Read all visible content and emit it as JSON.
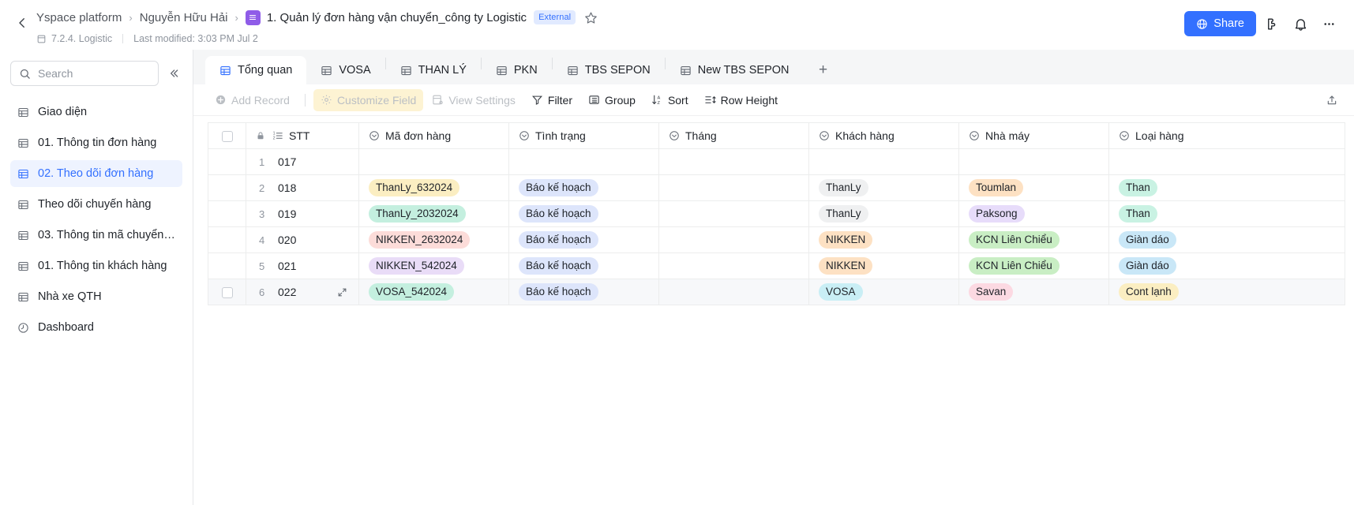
{
  "header": {
    "back_icon": "chevron-left-icon",
    "breadcrumb": [
      {
        "label": "Yspace platform"
      },
      {
        "label": "Nguyễn Hữu Hải"
      }
    ],
    "title": "1. Quản lý đơn hàng vận chuyển_công ty Logistic",
    "badge": "External",
    "star_icon": "star-icon",
    "doc_icon": "base-table-icon",
    "sub_icon": "file-icon",
    "sub_label": "7.2.4. Logistic",
    "last_modified": "Last modified: 3:03 PM Jul 2",
    "share_label": "Share",
    "share_icon": "globe-icon",
    "share_color": "#3370ff",
    "actions": [
      {
        "icon": "extension-icon"
      },
      {
        "icon": "bell-icon"
      },
      {
        "icon": "more-horizontal-icon"
      }
    ]
  },
  "sidebar": {
    "search": {
      "placeholder": "Search",
      "value": "",
      "icon": "search-icon"
    },
    "collapse_icon": "double-chevron-left-icon",
    "items": [
      {
        "label": "Giao diện",
        "icon": "table-icon",
        "active": false
      },
      {
        "label": "01. Thông tin đơn hàng",
        "icon": "table-icon",
        "active": false
      },
      {
        "label": "02. Theo dõi đơn hàng",
        "icon": "table-icon",
        "active": true
      },
      {
        "label": "Theo dõi chuyến hàng",
        "icon": "table-icon",
        "active": false
      },
      {
        "label": "03. Thông tin mã chuyển h...",
        "icon": "table-icon",
        "active": false
      },
      {
        "label": "01. Thông tin khách hàng",
        "icon": "table-icon",
        "active": false
      },
      {
        "label": "Nhà xe QTH",
        "icon": "table-icon",
        "active": false
      },
      {
        "label": "Dashboard",
        "icon": "dashboard-icon",
        "active": false
      }
    ]
  },
  "tabs": {
    "items": [
      {
        "label": "Tổng quan",
        "icon": "table-icon",
        "active": true
      },
      {
        "label": "VOSA",
        "icon": "table-icon",
        "active": false
      },
      {
        "label": "THAN LÝ",
        "icon": "table-icon",
        "active": false
      },
      {
        "label": "PKN",
        "icon": "table-icon",
        "active": false
      },
      {
        "label": "TBS SEPON",
        "icon": "table-icon",
        "active": false
      },
      {
        "label": "New TBS SEPON",
        "icon": "table-icon",
        "active": false
      }
    ],
    "add_label": "+"
  },
  "toolbar": {
    "add_record": {
      "label": "Add Record",
      "icon": "plus-circle-icon",
      "disabled": true
    },
    "customize_field": {
      "label": "Customize Field",
      "icon": "gear-icon",
      "disabled": true,
      "highlighted": true,
      "highlight_color": "#fdf3d3"
    },
    "view_settings": {
      "label": "View Settings",
      "icon": "view-settings-icon",
      "disabled": true
    },
    "filter": {
      "label": "Filter",
      "icon": "filter-icon"
    },
    "group": {
      "label": "Group",
      "icon": "group-icon"
    },
    "sort": {
      "label": "Sort",
      "icon": "sort-icon"
    },
    "row_height": {
      "label": "Row Height",
      "icon": "row-height-icon"
    },
    "share_view_icon": "share-arrow-icon"
  },
  "grid": {
    "columns": [
      {
        "key": "stt",
        "label": "STT",
        "icon": "autonumber-icon",
        "locked": true
      },
      {
        "key": "ma_don_hang",
        "label": "Mã đơn hàng",
        "icon": "single-select-icon"
      },
      {
        "key": "tinh_trang",
        "label": "Tình trạng",
        "icon": "single-select-icon"
      },
      {
        "key": "thang",
        "label": "Tháng",
        "icon": "single-select-icon"
      },
      {
        "key": "khach_hang",
        "label": "Khách hàng",
        "icon": "single-select-icon"
      },
      {
        "key": "nha_may",
        "label": "Nhà máy",
        "icon": "single-select-icon"
      },
      {
        "key": "loai_hang",
        "label": "Loại hàng",
        "icon": "single-select-icon"
      }
    ],
    "rows": [
      {
        "num": "1",
        "stt": "017",
        "ma_don_hang": null,
        "tinh_trang": null,
        "thang": null,
        "khach_hang": null,
        "nha_may": null,
        "loai_hang": null,
        "hover": false
      },
      {
        "num": "2",
        "stt": "018",
        "ma_don_hang": {
          "text": "ThanLy_632024",
          "color": "#fbeec2"
        },
        "tinh_trang": {
          "text": "Báo kế hoạch",
          "color": "#dde5fb"
        },
        "thang": null,
        "khach_hang": {
          "text": "ThanLy",
          "color": "#eff0f1"
        },
        "nha_may": {
          "text": "Toumlan",
          "color": "#fde1c3"
        },
        "loai_hang": {
          "text": "Than",
          "color": "#c9f2e3"
        },
        "hover": false
      },
      {
        "num": "3",
        "stt": "019",
        "ma_don_hang": {
          "text": "ThanLy_2032024",
          "color": "#c4efdf"
        },
        "tinh_trang": {
          "text": "Báo kế hoạch",
          "color": "#dde5fb"
        },
        "thang": null,
        "khach_hang": {
          "text": "ThanLy",
          "color": "#eff0f1"
        },
        "nha_may": {
          "text": "Paksong",
          "color": "#e7dcfa"
        },
        "loai_hang": {
          "text": "Than",
          "color": "#c9f2e3"
        },
        "hover": false
      },
      {
        "num": "4",
        "stt": "020",
        "ma_don_hang": {
          "text": "NIKKEN_2632024",
          "color": "#fcdcd9"
        },
        "tinh_trang": {
          "text": "Báo kế hoạch",
          "color": "#dde5fb"
        },
        "thang": null,
        "khach_hang": {
          "text": "NIKKEN",
          "color": "#fde1c3"
        },
        "nha_may": {
          "text": "KCN Liên Chiểu",
          "color": "#c9eec4"
        },
        "loai_hang": {
          "text": "Giàn dáo",
          "color": "#c9e7f7"
        },
        "hover": false
      },
      {
        "num": "5",
        "stt": "021",
        "ma_don_hang": {
          "text": "NIKKEN_542024",
          "color": "#e9dcf7"
        },
        "tinh_trang": {
          "text": "Báo kế hoạch",
          "color": "#dde5fb"
        },
        "thang": null,
        "khach_hang": {
          "text": "NIKKEN",
          "color": "#fde1c3"
        },
        "nha_may": {
          "text": "KCN Liên Chiểu",
          "color": "#c9eec4"
        },
        "loai_hang": {
          "text": "Giàn dáo",
          "color": "#c9e7f7"
        },
        "hover": false
      },
      {
        "num": "6",
        "stt": "022",
        "ma_don_hang": {
          "text": "VOSA_542024",
          "color": "#c4efdf"
        },
        "tinh_trang": {
          "text": "Báo kế hoạch",
          "color": "#dde5fb"
        },
        "thang": null,
        "khach_hang": {
          "text": "VOSA",
          "color": "#c9eef5"
        },
        "nha_may": {
          "text": "Savan",
          "color": "#fcd9e2"
        },
        "loai_hang": {
          "text": "Cont lạnh",
          "color": "#fbeec2"
        },
        "hover": true
      }
    ]
  }
}
